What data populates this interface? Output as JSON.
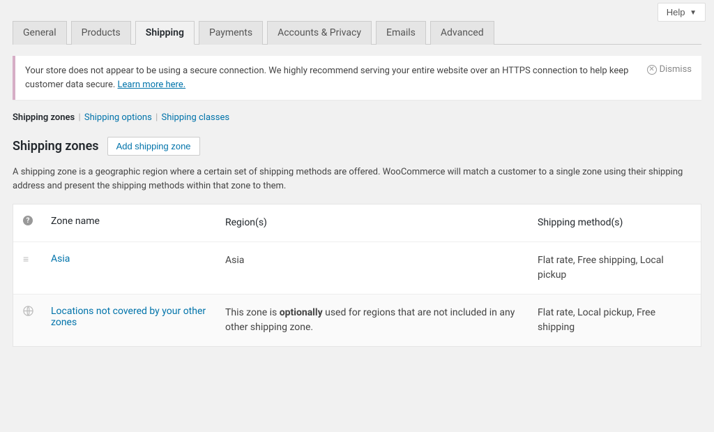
{
  "help": {
    "label": "Help"
  },
  "tabs": [
    {
      "label": "General"
    },
    {
      "label": "Products"
    },
    {
      "label": "Shipping",
      "active": true
    },
    {
      "label": "Payments"
    },
    {
      "label": "Accounts & Privacy"
    },
    {
      "label": "Emails"
    },
    {
      "label": "Advanced"
    }
  ],
  "notice": {
    "text_pre": "Your store does not appear to be using a secure connection. We highly recommend serving your entire website over an HTTPS connection to help keep customer data secure. ",
    "link_text": "Learn more here.",
    "dismiss_label": "Dismiss"
  },
  "subnav": {
    "items": [
      {
        "label": "Shipping zones",
        "active": true
      },
      {
        "label": "Shipping options"
      },
      {
        "label": "Shipping classes"
      }
    ]
  },
  "heading": {
    "title": "Shipping zones",
    "add_button": "Add shipping zone"
  },
  "description": "A shipping zone is a geographic region where a certain set of shipping methods are offered. WooCommerce will match a customer to a single zone using their shipping address and present the shipping methods within that zone to them.",
  "table": {
    "headers": {
      "name": "Zone name",
      "region": "Region(s)",
      "method": "Shipping method(s)"
    },
    "rows": [
      {
        "name": "Asia",
        "region": "Asia",
        "method": "Flat rate, Free shipping, Local pickup"
      },
      {
        "name": "Locations not covered by your other zones",
        "region_pre": "This zone is ",
        "region_strong": "optionally",
        "region_post": " used for regions that are not included in any other shipping zone.",
        "method": "Flat rate, Local pickup, Free shipping"
      }
    ]
  }
}
